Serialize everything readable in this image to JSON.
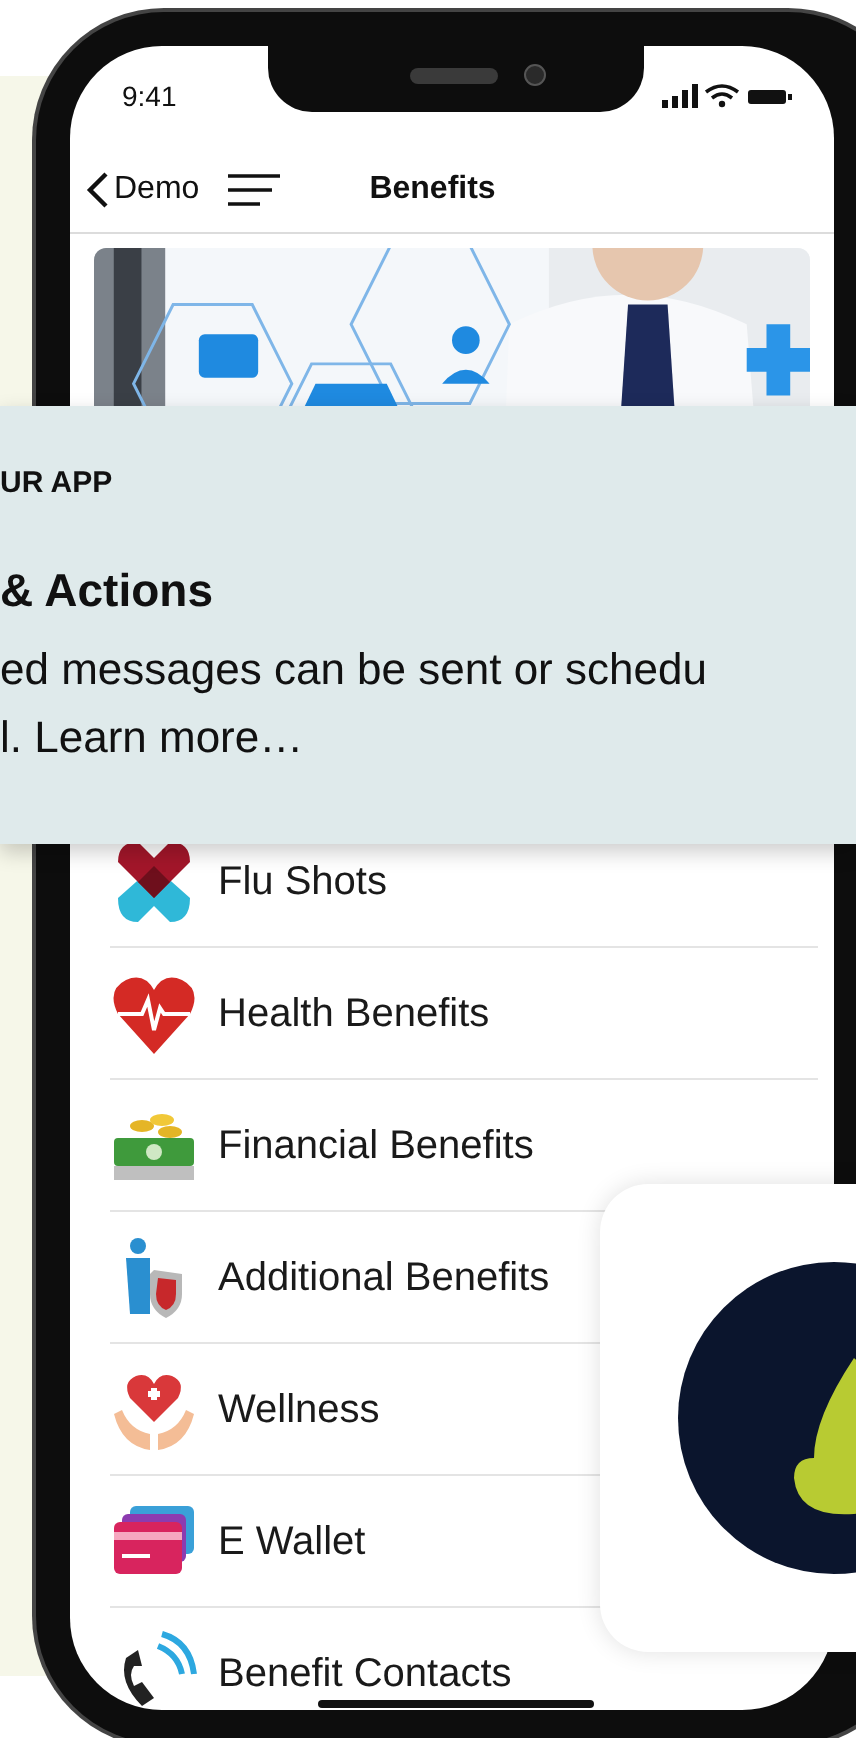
{
  "status_bar": {
    "time": "9:41"
  },
  "nav": {
    "back_label": "Demo",
    "title": "Benefits"
  },
  "menu_items": [
    {
      "label": "Flu Shots",
      "kind": "flu"
    },
    {
      "label": "Health Benefits",
      "kind": "heart"
    },
    {
      "label": "Financial Benefits",
      "kind": "money"
    },
    {
      "label": "Additional Benefits",
      "kind": "shield"
    },
    {
      "label": "Wellness",
      "kind": "care"
    },
    {
      "label": "E Wallet",
      "kind": "wallet"
    },
    {
      "label": "Benefit Contacts",
      "kind": "phone"
    }
  ],
  "overlay_card": {
    "eyebrow": "UR APP",
    "title": "& Actions",
    "body_lines": [
      "ed messages can be sent or schedu",
      "l. Learn more…"
    ]
  }
}
